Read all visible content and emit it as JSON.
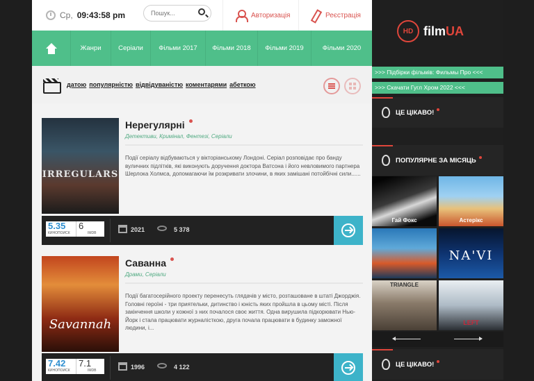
{
  "header": {
    "day": "Ср,",
    "time": "09:43:58 pm",
    "search_placeholder": "Пошук...",
    "login_label": "Авторизація",
    "register_label": "Реєстрація"
  },
  "nav": {
    "items": [
      "Жанри",
      "Серіали",
      "Фільми 2017",
      "Фільми 2018",
      "Фільми 2019",
      "Фільми 2020"
    ]
  },
  "sort": {
    "links": [
      "датою",
      "популярністю",
      "відвідуваністю",
      "коментарями",
      "абеткою"
    ]
  },
  "movies": [
    {
      "title": "Нерегулярні",
      "genres": "Детективи, Кримінал, Фентезі, Серіали",
      "description": "Події серіалу відбуваються у вікторіанському Лондоні. Серіал розповідає про банду вуличних підлітків, які виконують доручення доктора Ватсона і його невловимого партнера Шерлока Холмса, допомагаючи їм розкривати злочини, в яких замішані потойбічні сили......",
      "poster_text": "IRREGULARS",
      "kp_rating": "5.35",
      "kp_label": "КИНОПОИСК",
      "imdb_rating": "6",
      "imdb_label": "IMDB",
      "year": "2021",
      "views": "5 378"
    },
    {
      "title": "Саванна",
      "genres": "Драми, Серіали",
      "description": "Події багатосерійного проекту перенесуть глядачів у місто, розташоване в штаті Джорджія. Головні героїні - три приятельки, дитинство і юність яких пройшла в цьому місті. Після закінчення школи у кожної з них почалося своє життя. Одна вирушила підкорювати Нью-Йорк і стала працювати журналісткою, друга почала працювати в будинку заможної людини, і...",
      "poster_text": "Savannah",
      "kp_rating": "7.42",
      "kp_label": "КИНОПОИСК",
      "imdb_rating": "7.1",
      "imdb_label": "IMDB",
      "year": "1996",
      "views": "4 122"
    }
  ],
  "sidebar": {
    "logo_hd": "HD",
    "logo_film": "film",
    "logo_ua": "UA",
    "promo1": ">>> Підбірки фільмів: Фильмы Про <<<",
    "promo2": ">>> Скачати Гугл Хром 2022 <<<",
    "block1_title": "ЦЕ ЦІКАВО!",
    "block2_title": "ПОПУЛЯРНЕ ЗА МІСЯЦЬ",
    "block3_title": "ЦЕ ЦІКАВО!",
    "thumb_texts": [
      "Гай Фокс",
      "Астерікс",
      "",
      "NA'VI",
      "TRIANGLE",
      "LEFT"
    ]
  }
}
